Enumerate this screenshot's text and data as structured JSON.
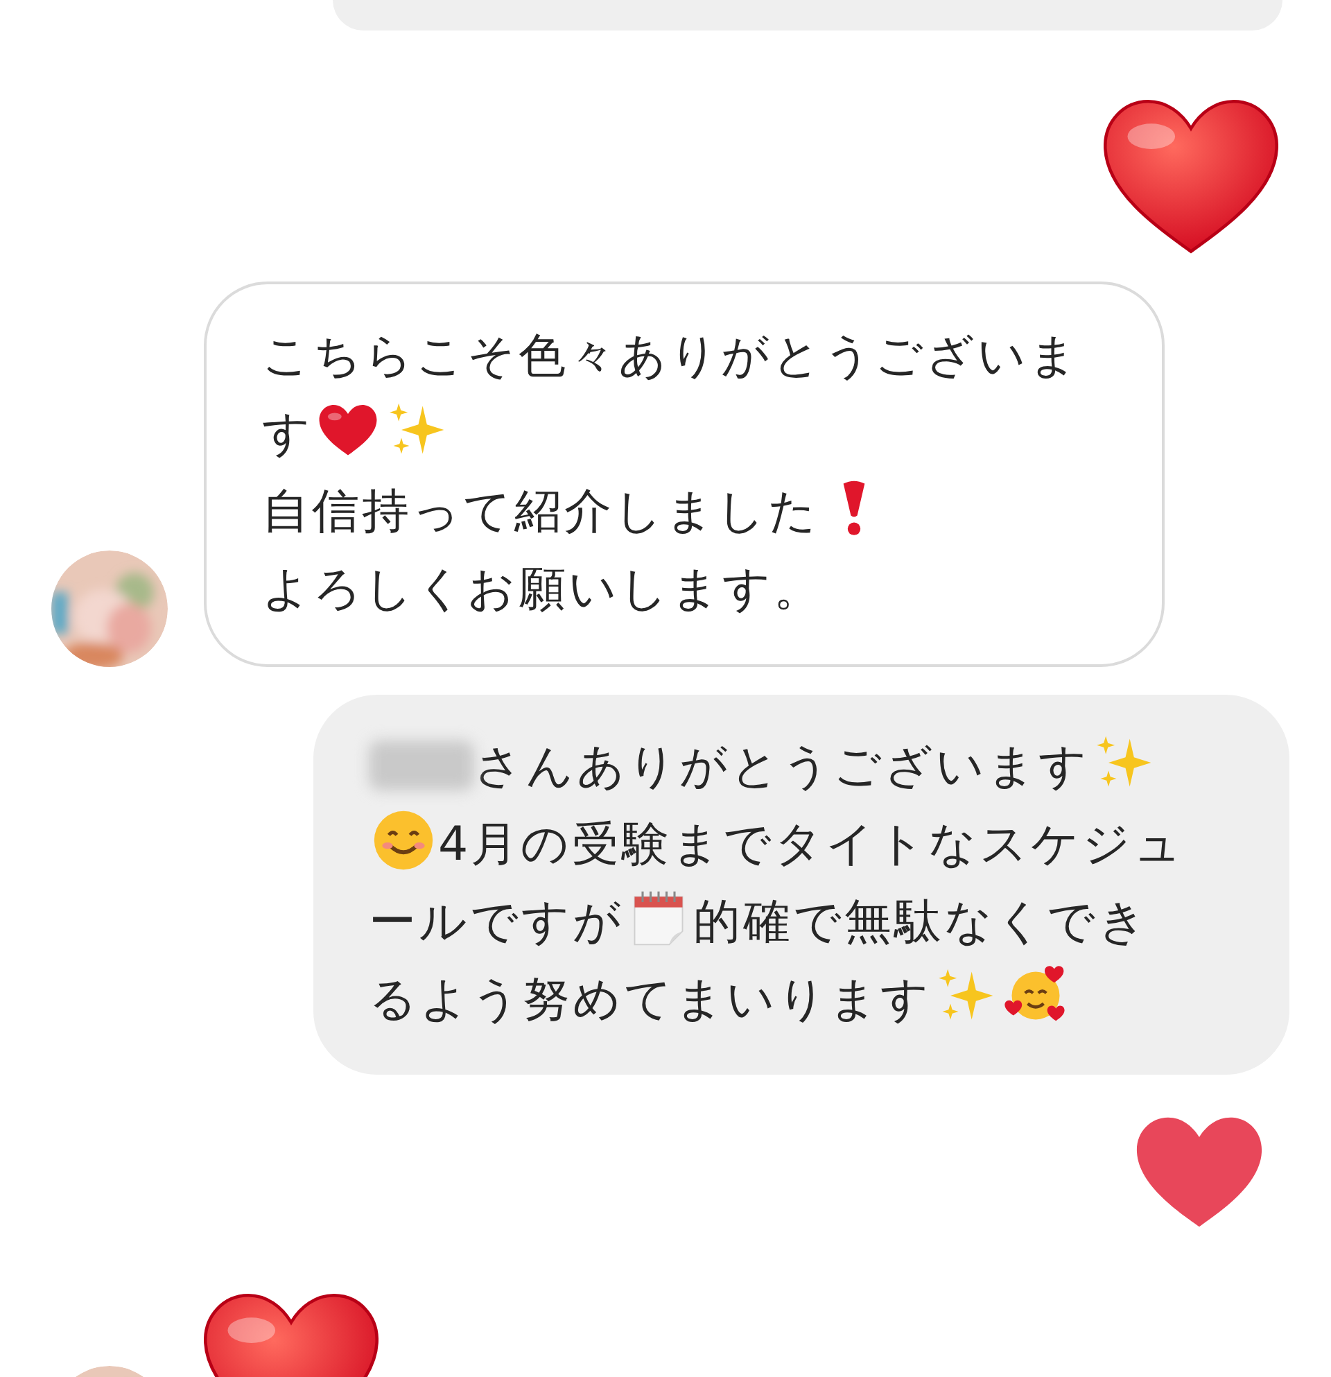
{
  "messages": [
    {
      "kind": "stub",
      "sent": true
    },
    {
      "kind": "emoji_heart",
      "sent": true
    },
    {
      "kind": "text",
      "sent": false,
      "lines": [
        [
          {
            "kind": "text",
            "text": "こちらこそ色々ありがとうございま"
          }
        ],
        [
          {
            "kind": "text",
            "text": "す"
          },
          {
            "kind": "heart"
          },
          {
            "kind": "sparkles"
          }
        ],
        [
          {
            "kind": "text",
            "text": "自信持って紹介しました"
          },
          {
            "kind": "exclamation"
          }
        ],
        [
          {
            "kind": "text",
            "text": "よろしくお願いします。"
          }
        ]
      ]
    },
    {
      "kind": "text",
      "sent": true,
      "lines": [
        [
          {
            "kind": "blur"
          },
          {
            "kind": "text",
            "text": "さんありがとうございます"
          },
          {
            "kind": "sparkles"
          }
        ],
        [
          {
            "kind": "smile"
          },
          {
            "kind": "text",
            "text": "4月の受験までタイトなスケジュ"
          }
        ],
        [
          {
            "kind": "text",
            "text": "ールですが"
          },
          {
            "kind": "calendar"
          },
          {
            "kind": "text",
            "text": "的確で無駄なくでき"
          }
        ],
        [
          {
            "kind": "text",
            "text": "るよう努めてまいります"
          },
          {
            "kind": "sparkles"
          },
          {
            "kind": "blush"
          }
        ]
      ]
    },
    {
      "kind": "like",
      "sent": true
    },
    {
      "kind": "emoji_heart",
      "sent": false
    }
  ]
}
